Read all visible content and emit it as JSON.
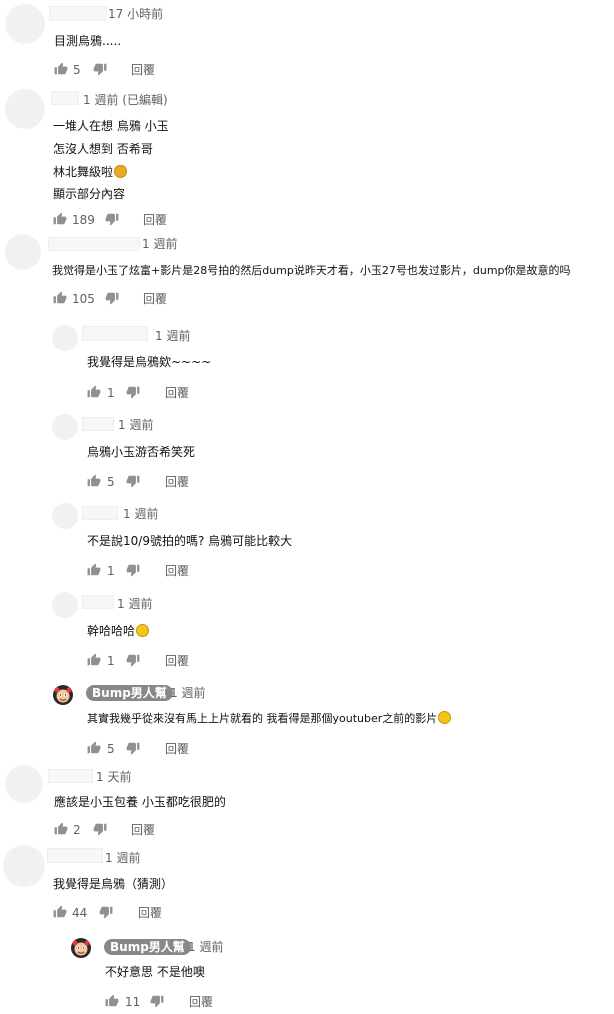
{
  "reply_label": "回覆",
  "comments": [
    {
      "time": "17 小時前",
      "lines": [
        "目測烏鴉....."
      ],
      "likes": "5"
    },
    {
      "time": "1 週前 (已編輯)",
      "lines": [
        "一堆人在想 烏鴉 小玉",
        "怎沒人想到 否希哥",
        "林北舞級啦",
        "顯示部分內容"
      ],
      "likes": "189"
    },
    {
      "time": "1 週前",
      "lines": [
        "我觉得是小玉了炫富+影片是28号拍的然后dump说昨天才看，小玉27号也发过影片，dump你是故意的吗"
      ],
      "likes": "105"
    },
    {
      "time": "1 週前",
      "lines": [
        "我覺得是烏鴉欸~~~~"
      ],
      "likes": "1"
    },
    {
      "time": "1 週前",
      "lines": [
        "烏鴉小玉游否希笑死"
      ],
      "likes": "5"
    },
    {
      "time": "1 週前",
      "lines": [
        "不是說10/9號拍的嗎? 烏鴉可能比較大"
      ],
      "likes": "1"
    },
    {
      "time": "1 週前",
      "lines": [
        "幹哈哈哈"
      ],
      "likes": "1"
    },
    {
      "author": "Bump男人幫",
      "time": "1 週前",
      "lines": [
        "其實我幾乎從來沒有馬上上片就看的 我看得是那個youtuber之前的影片"
      ],
      "likes": "5"
    },
    {
      "time": "1 天前",
      "lines": [
        "應該是小玉包養 小玉都吃很肥的"
      ],
      "likes": "2"
    },
    {
      "time": "1 週前",
      "lines": [
        "我覺得是烏鴉（猜測）"
      ],
      "likes": "44"
    },
    {
      "author": "Bump男人幫",
      "time": "1 週前",
      "lines": [
        "不好意思 不是他噢"
      ],
      "likes": "11"
    }
  ]
}
